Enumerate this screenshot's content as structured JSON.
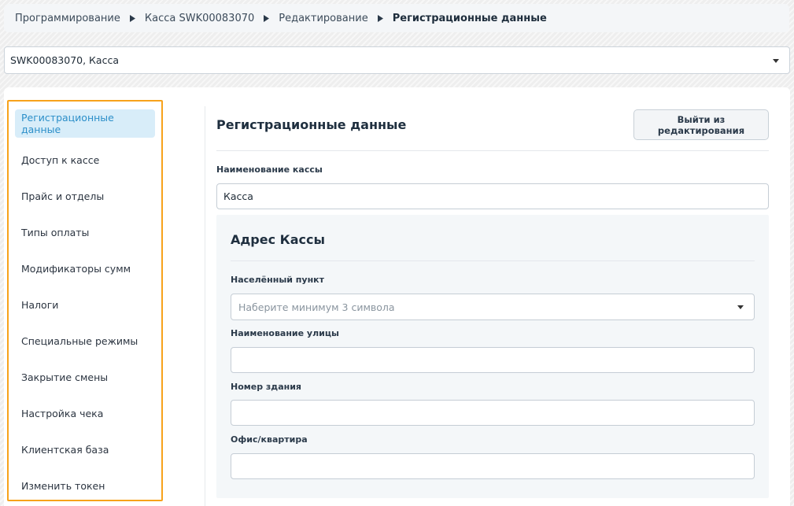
{
  "breadcrumb": {
    "items": [
      "Программирование",
      "Касса SWK00083070",
      "Редактирование",
      "Регистрационные данные"
    ]
  },
  "device_select": {
    "value": "SWK00083070, Касса"
  },
  "sidebar": {
    "items": [
      {
        "label": "Регистрационные данные",
        "active": true
      },
      {
        "label": "Доступ к кассе"
      },
      {
        "label": "Прайс и отделы"
      },
      {
        "label": "Типы оплаты"
      },
      {
        "label": "Модификаторы сумм"
      },
      {
        "label": "Налоги"
      },
      {
        "label": "Специальные режимы"
      },
      {
        "label": "Закрытие смены"
      },
      {
        "label": "Настройка чека"
      },
      {
        "label": "Клиентская база"
      },
      {
        "label": "Изменить токен"
      }
    ]
  },
  "main": {
    "title": "Регистрационные данные",
    "exit_button": "Выйти из редактирования",
    "cash_name": {
      "label": "Наименование кассы",
      "value": "Касса"
    }
  },
  "address": {
    "title": "Адрес Кассы",
    "city": {
      "label": "Населённый пункт",
      "placeholder": "Наберите минимум 3 символа"
    },
    "street": {
      "label": "Наименование улицы",
      "value": ""
    },
    "building": {
      "label": "Номер здания",
      "value": ""
    },
    "office": {
      "label": "Офис/квартира",
      "value": ""
    }
  },
  "colors": {
    "accent": "#2c8fc9",
    "active_bg": "#d8edf9",
    "highlight_border": "#f7a21b"
  }
}
